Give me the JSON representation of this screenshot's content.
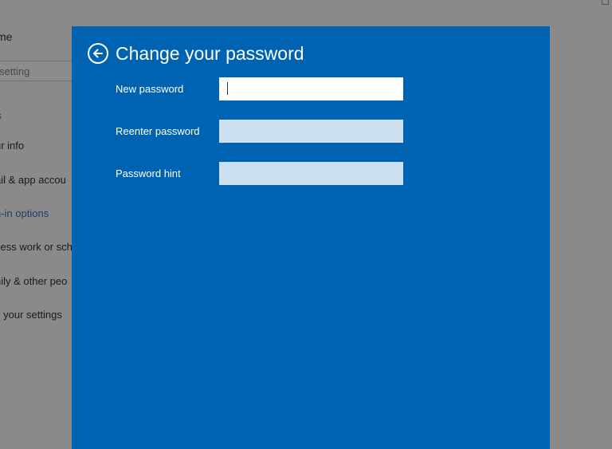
{
  "background": {
    "home_label": "me",
    "search_placeholder": "setting",
    "section_label": "s",
    "nav_items": [
      {
        "label": "ur info",
        "active": false
      },
      {
        "label": "ail & app accou",
        "active": false
      },
      {
        "label": "n-in options",
        "active": true
      },
      {
        "label": "cess work or sch",
        "active": false
      },
      {
        "label": "nily & other peo",
        "active": false
      },
      {
        "label": "c your settings",
        "active": false
      }
    ]
  },
  "dialog": {
    "title": "Change your password",
    "back_icon": "back-arrow-icon",
    "fields": [
      {
        "label": "New password",
        "value": "",
        "focused": true
      },
      {
        "label": "Reenter password",
        "value": "",
        "focused": false
      },
      {
        "label": "Password hint",
        "value": "",
        "focused": false
      }
    ]
  },
  "colors": {
    "dialog_bg": "#0063b1",
    "overlay_bg": "#8a8a8a",
    "input_active": "#ffffff",
    "input_inactive": "#cde0f0"
  }
}
